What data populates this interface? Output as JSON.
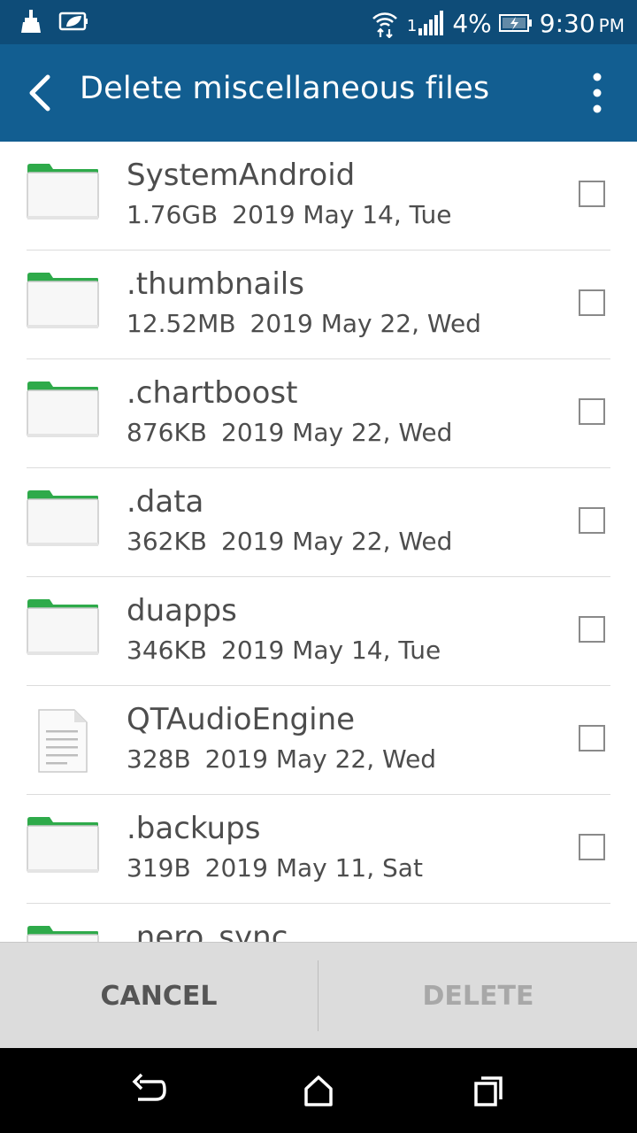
{
  "status_bar": {
    "signal_label": "1",
    "battery": "4%",
    "time": "9:30",
    "ampm": "PM"
  },
  "app_bar": {
    "title": "Delete miscellaneous files"
  },
  "files": [
    {
      "name": "SystemAndroid",
      "size": "1.76GB",
      "date": "2019 May 14, Tue",
      "type": "folder",
      "checked": false
    },
    {
      "name": ".thumbnails",
      "size": "12.52MB",
      "date": "2019 May 22, Wed",
      "type": "folder",
      "checked": false
    },
    {
      "name": ".chartboost",
      "size": "876KB",
      "date": "2019 May 22, Wed",
      "type": "folder",
      "checked": false
    },
    {
      "name": ".data",
      "size": "362KB",
      "date": "2019 May 22, Wed",
      "type": "folder",
      "checked": false
    },
    {
      "name": "duapps",
      "size": "346KB",
      "date": "2019 May 14, Tue",
      "type": "folder",
      "checked": false
    },
    {
      "name": "QTAudioEngine",
      "size": "328B",
      "date": "2019 May 22, Wed",
      "type": "file",
      "checked": false
    },
    {
      "name": ".backups",
      "size": "319B",
      "date": "2019 May 11, Sat",
      "type": "folder",
      "checked": false
    },
    {
      "name": ".nero_sync",
      "size": "",
      "date": "",
      "type": "folder",
      "checked": false
    }
  ],
  "actions": {
    "cancel": "CANCEL",
    "delete": "DELETE"
  },
  "colors": {
    "status_bar": "#0e4c78",
    "app_bar": "#125e91",
    "folder_tab": "#2eaa4a"
  },
  "icons": {
    "back": "back-arrow-icon",
    "overflow": "more-vert-icon",
    "folder": "folder-icon",
    "file": "document-icon",
    "nav_back": "nav-back-icon",
    "nav_home": "nav-home-icon",
    "nav_recents": "nav-recents-icon"
  }
}
